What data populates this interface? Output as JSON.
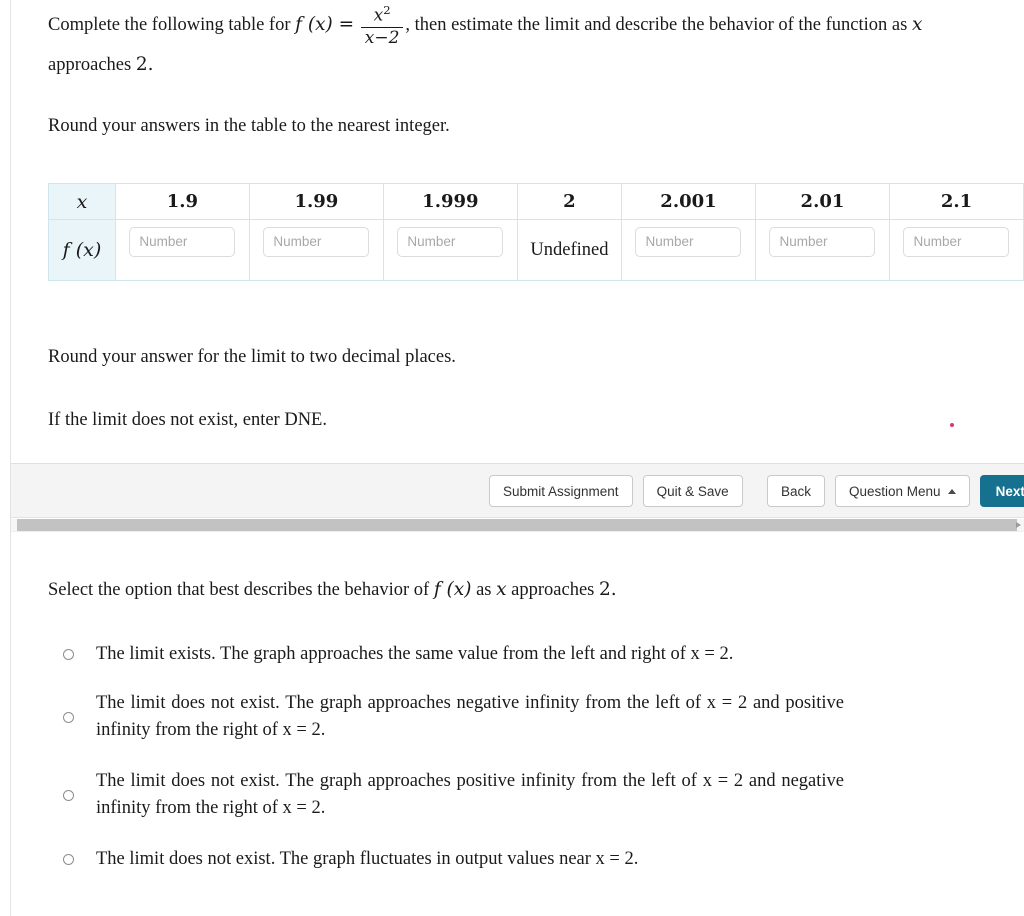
{
  "question": {
    "intro_before_math": "Complete the following table for",
    "function_label": "f (x) =",
    "fraction_numerator": "x",
    "fraction_numerator_exponent": "2",
    "fraction_denominator": "x−2",
    "intro_after_math": ", then estimate the limit and describe the behavior of the function as",
    "intro_variable": "x",
    "intro_tail": "approaches",
    "intro_point": "2.",
    "round_table_note": "Round your answers in the table to the nearest integer.",
    "round_limit_note": "Round your answer for the limit to two decimal places.",
    "dne_note": "If the limit does not exist, enter DNE."
  },
  "table": {
    "row_label_x": "x",
    "row_label_fx": "f (x)",
    "x_values": [
      "1.9",
      "1.99",
      "1.999",
      "2",
      "2.001",
      "2.01",
      "2.1"
    ],
    "fx_cells": [
      {
        "type": "input",
        "value": "",
        "placeholder": "Number"
      },
      {
        "type": "input",
        "value": "",
        "placeholder": "Number"
      },
      {
        "type": "input",
        "value": "",
        "placeholder": "Number"
      },
      {
        "type": "text",
        "value": "Undefined"
      },
      {
        "type": "input",
        "value": "",
        "placeholder": "Number"
      },
      {
        "type": "input",
        "value": "",
        "placeholder": "Number"
      },
      {
        "type": "input",
        "value": "",
        "placeholder": "Number"
      }
    ],
    "header_bg": "#eaf5f9",
    "border_color": "#cfe6ee"
  },
  "toolbar": {
    "submit_label": "Submit Assignment",
    "quit_label": "Quit & Save",
    "back_label": "Back",
    "question_menu_label": "Question Menu",
    "next_label": "Next",
    "primary_color": "#16708f"
  },
  "lower": {
    "select_prompt_before": "Select the option that best describes the behavior of",
    "select_prompt_fx": "f (x)",
    "select_prompt_as": "as",
    "select_prompt_var": "x",
    "select_prompt_tail": "approaches",
    "select_prompt_point": "2.",
    "options": [
      {
        "id": "limit-exists",
        "text": "The limit exists. The graph approaches the same value from the left and right of x = 2.",
        "selected": false
      },
      {
        "id": "dne-neg-left-pos-right",
        "text": "The limit does not exist. The graph approaches negative infinity from the left of x = 2 and positive infinity from the right of x = 2.",
        "selected": false
      },
      {
        "id": "dne-pos-left-neg-right",
        "text": "The limit does not exist. The graph approaches positive infinity from the left of x = 2 and negative infinity from the right of x = 2.",
        "selected": false
      },
      {
        "id": "dne-fluctuates",
        "text": "The limit does not exist. The graph fluctuates in output values near x = 2.",
        "selected": false
      }
    ]
  }
}
